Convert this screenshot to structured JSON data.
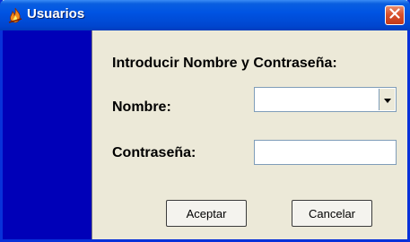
{
  "window": {
    "title": "Usuarios",
    "app_icon": "flame-icon",
    "close_icon": "close-icon"
  },
  "colors": {
    "side_panel": "#0000b8",
    "titlebar": "#0054e3",
    "dialog_bg": "#ece9d8"
  },
  "form": {
    "heading": "Introducir Nombre y Contraseña:",
    "nombre_label": "Nombre:",
    "nombre_value": "",
    "nombre_dropdown_icon": "chevron-down-icon",
    "password_label": "Contraseña:",
    "password_value": ""
  },
  "buttons": {
    "accept_label": "Aceptar",
    "cancel_label": "Cancelar"
  }
}
